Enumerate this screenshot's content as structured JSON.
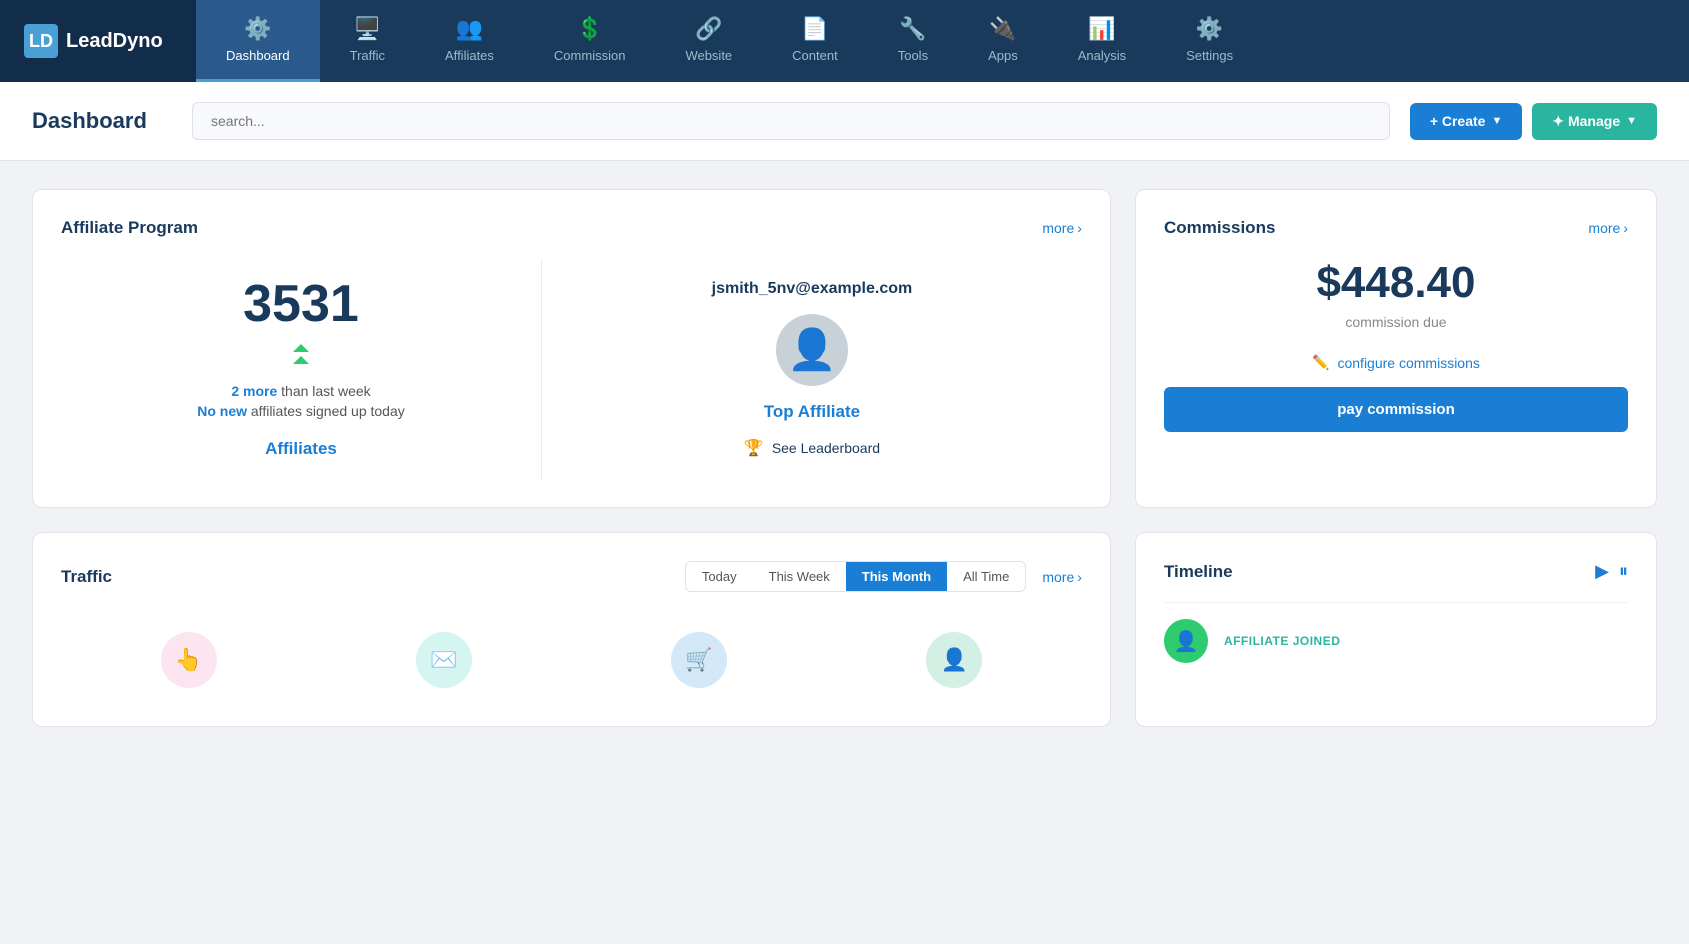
{
  "brand": {
    "icon": "LD",
    "name": "LeadDyno"
  },
  "nav": {
    "items": [
      {
        "id": "dashboard",
        "label": "Dashboard",
        "icon": "⚙",
        "active": true
      },
      {
        "id": "traffic",
        "label": "Traffic",
        "icon": "🖥",
        "active": false
      },
      {
        "id": "affiliates",
        "label": "Affiliates",
        "icon": "👥",
        "active": false
      },
      {
        "id": "commission",
        "label": "Commission",
        "icon": "💰",
        "active": false
      },
      {
        "id": "website",
        "label": "Website",
        "icon": "🔗",
        "active": false
      },
      {
        "id": "content",
        "label": "Content",
        "icon": "📄",
        "active": false
      },
      {
        "id": "tools",
        "label": "Tools",
        "icon": "🔧",
        "active": false
      },
      {
        "id": "apps",
        "label": "Apps",
        "icon": "🔌",
        "active": false
      },
      {
        "id": "analysis",
        "label": "Analysis",
        "icon": "📊",
        "active": false
      },
      {
        "id": "settings",
        "label": "Settings",
        "icon": "⚙",
        "active": false
      }
    ]
  },
  "header": {
    "title": "Dashboard",
    "search_placeholder": "search...",
    "create_label": "+ Create",
    "manage_label": "✦ Manage"
  },
  "affiliate_program": {
    "title": "Affiliate Program",
    "more_label": "more",
    "count": "3531",
    "change_text": "2 more than last week",
    "today_text": "No new affiliates signed up today",
    "affiliates_link": "Affiliates",
    "top_email": "jsmith_5nv@example.com",
    "top_label": "Top Affiliate",
    "leaderboard_label": "See Leaderboard"
  },
  "commissions": {
    "title": "Commissions",
    "more_label": "more",
    "amount": "$448.40",
    "due_label": "commission due",
    "configure_label": "configure commissions",
    "pay_label": "pay commission"
  },
  "traffic": {
    "title": "Traffic",
    "more_label": "more",
    "tabs": [
      {
        "label": "Today",
        "active": false
      },
      {
        "label": "This Week",
        "active": false
      },
      {
        "label": "This Month",
        "active": true
      },
      {
        "label": "All Time",
        "active": false
      }
    ]
  },
  "timeline": {
    "title": "Timeline",
    "event_label": "AFFILIATE JOINED"
  }
}
